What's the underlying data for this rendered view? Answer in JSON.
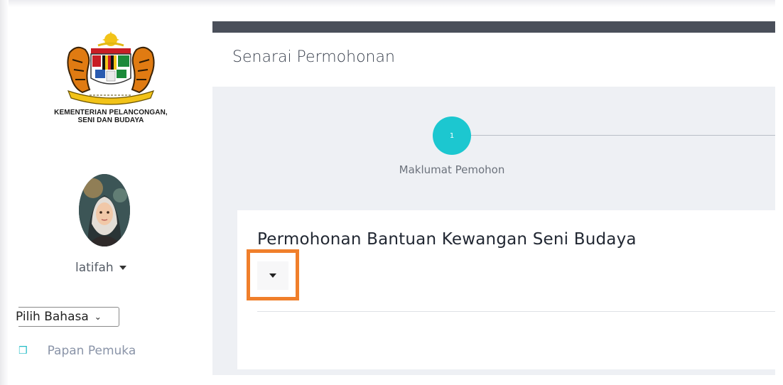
{
  "sidebar": {
    "ministry_line1": "KEMENTERIAN PELANCONGAN,",
    "ministry_line2": "SENI DAN BUDAYA",
    "username": "latifah",
    "language": "Pilih Bahasa",
    "nav": [
      {
        "label": "Papan Pemuka",
        "icon": "dashboard-icon"
      }
    ]
  },
  "main": {
    "page_title": "Senarai Permohonan",
    "stepper": [
      {
        "number": "1",
        "label": "Maklumat Pemohon"
      }
    ],
    "card_title": "Permohonan Bantuan Kewangan Seni Budaya"
  },
  "colors": {
    "accent": "#1cc7d0",
    "topbar": "#4a4f5a",
    "highlight": "#f07f2b"
  }
}
